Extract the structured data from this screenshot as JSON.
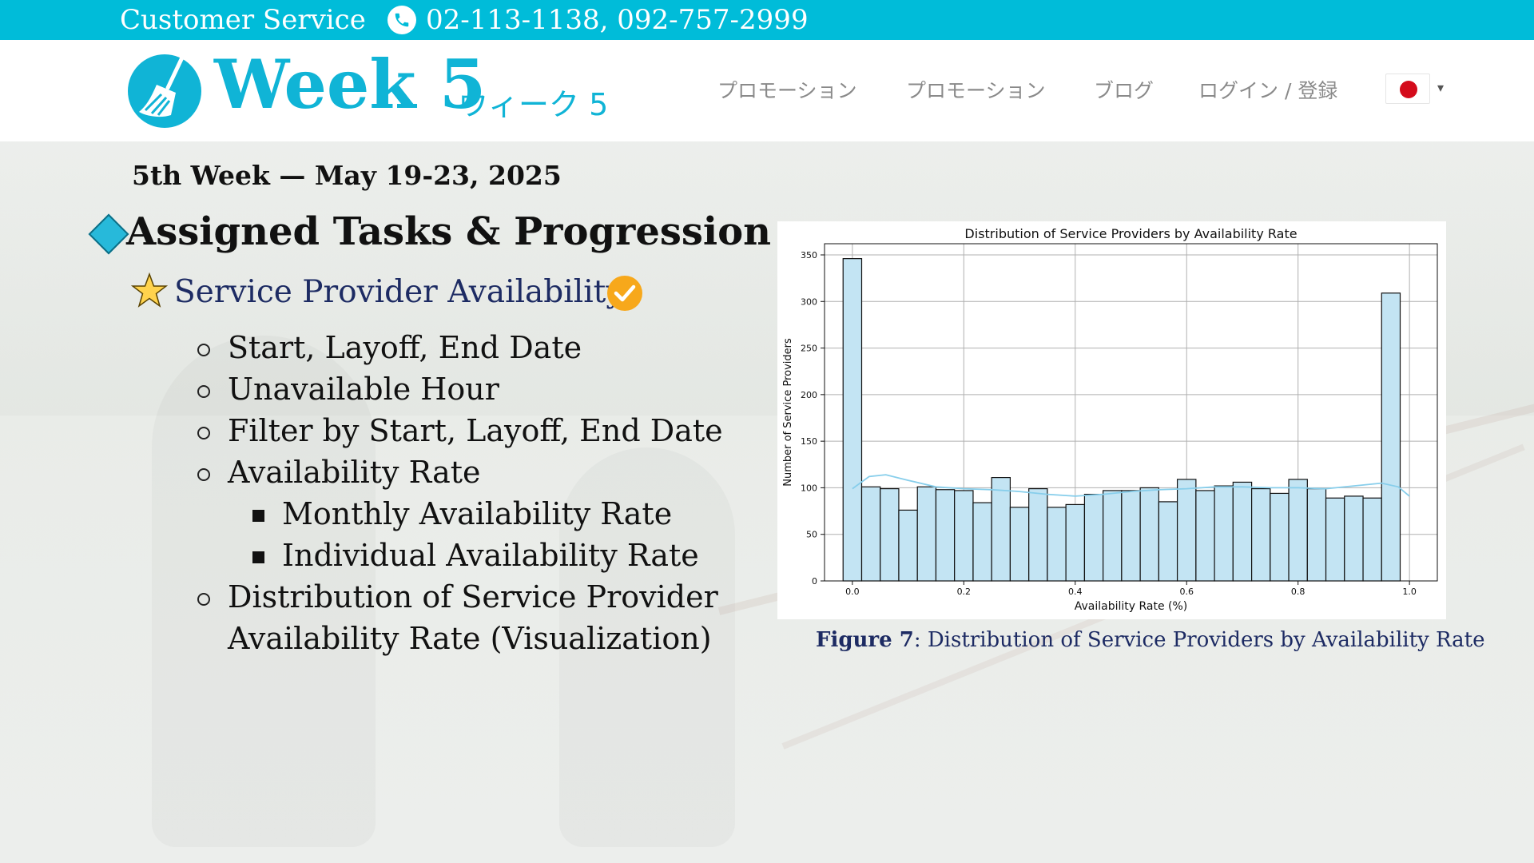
{
  "topbar": {
    "customer_service": "Customer Service",
    "phones": "02-113-1138, 092-757-2999"
  },
  "header": {
    "logo_text": "Week 5",
    "logo_sub": "ウィーク 5",
    "nav": [
      "プロモーション",
      "プロモーション",
      "ブログ",
      "ログイン / 登録"
    ],
    "language_caret": "▾"
  },
  "content": {
    "week_date": "5th Week — May 19-23, 2025",
    "section_title": "Assigned Tasks & Progression",
    "sub_title": "Service Provider Availability",
    "items": [
      "Start, Layoff, End Date",
      "Unavailable Hour",
      "Filter by Start, Layoff, End Date",
      "Availability Rate",
      "Monthly Availability Rate",
      "Individual Availability Rate",
      "Distribution of Service Provider",
      "Availability Rate (Visualization)"
    ]
  },
  "caption": {
    "label": "Figure 7",
    "text": ": Distribution of Service Providers by Availability Rate"
  },
  "colors": {
    "accent": "#00bcd9",
    "brand_text": "#10b4d6",
    "bar_fill": "#c3e4f3",
    "kde_line": "#87ceeb",
    "check": "#f7a81b"
  },
  "chart_data": {
    "type": "bar",
    "title": "Distribution of Service Providers by Availability Rate",
    "xlabel": "Availability Rate (%)",
    "ylabel": "Number of Service Providers",
    "xlim": [
      -0.05,
      1.05
    ],
    "ylim": [
      0,
      362
    ],
    "grid": true,
    "x_ticks": [
      "0.0",
      "0.2",
      "0.4",
      "0.6",
      "0.8",
      "1.0"
    ],
    "y_ticks": [
      "0",
      "50",
      "100",
      "150",
      "200",
      "250",
      "300",
      "350"
    ],
    "bin_edges": [
      -0.0167,
      0.0167,
      0.05,
      0.0833,
      0.1167,
      0.15,
      0.1833,
      0.2167,
      0.25,
      0.2833,
      0.3167,
      0.35,
      0.3833,
      0.4167,
      0.45,
      0.4833,
      0.5167,
      0.55,
      0.5833,
      0.6167,
      0.65,
      0.6833,
      0.7167,
      0.75,
      0.7833,
      0.8167,
      0.85,
      0.8833,
      0.9167,
      0.95,
      0.9833,
      1.0167
    ],
    "values": [
      346,
      101,
      99,
      76,
      101,
      98,
      97,
      84,
      111,
      79,
      99,
      79,
      82,
      93,
      97,
      97,
      100,
      85,
      109,
      97,
      102,
      106,
      99,
      94,
      109,
      99,
      89,
      91,
      89,
      309
    ],
    "kde": [
      [
        -0.0,
        99
      ],
      [
        0.03,
        112
      ],
      [
        0.06,
        114
      ],
      [
        0.1,
        108
      ],
      [
        0.15,
        101
      ],
      [
        0.2,
        99
      ],
      [
        0.25,
        98
      ],
      [
        0.3,
        96
      ],
      [
        0.35,
        93
      ],
      [
        0.4,
        91
      ],
      [
        0.45,
        93
      ],
      [
        0.5,
        96
      ],
      [
        0.55,
        98
      ],
      [
        0.6,
        99
      ],
      [
        0.65,
        101
      ],
      [
        0.7,
        101
      ],
      [
        0.75,
        100
      ],
      [
        0.8,
        100
      ],
      [
        0.85,
        99
      ],
      [
        0.9,
        102
      ],
      [
        0.95,
        105
      ],
      [
        0.98,
        101
      ],
      [
        1.0,
        91
      ]
    ]
  }
}
